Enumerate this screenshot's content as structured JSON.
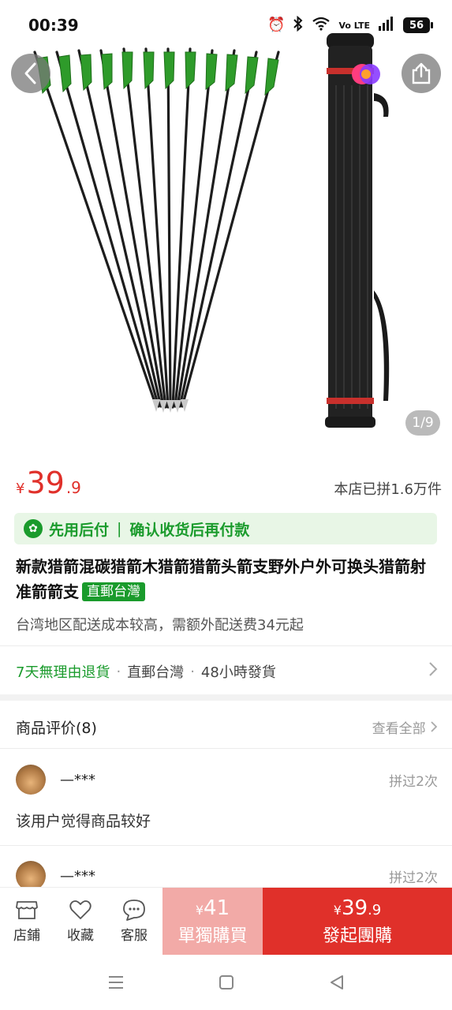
{
  "status_bar": {
    "time": "00:39",
    "network": "Vo LTE",
    "battery": "56"
  },
  "gallery": {
    "counter": "1/9"
  },
  "price": {
    "currency": "¥",
    "integer": "39",
    "decimal": ".9",
    "sold_text": "本店已拼1.6万件"
  },
  "pay_later": {
    "label": "先用后付",
    "separator": "|",
    "desc": "确认收货后再付款"
  },
  "product": {
    "title": "新款猎箭混碳猎箭木猎箭猎箭头箭支野外户外可换头猎箭射准箭箭支",
    "tag": "直郵台灣",
    "shipping_note": "台湾地区配送成本较高，需额外配送费34元起"
  },
  "services": {
    "return": "7天無理由退貨",
    "direct": "直郵台灣",
    "ship_time": "48小時發貨",
    "dot": "·"
  },
  "reviews": {
    "title": "商品评价(8)",
    "see_all": "查看全部",
    "items": [
      {
        "user": "—***",
        "joined": "拼过2次",
        "text": "该用户觉得商品较好"
      },
      {
        "user": "—***",
        "joined": "拼过2次"
      }
    ]
  },
  "action_bar": {
    "store": "店鋪",
    "favorite": "收藏",
    "service": "客服",
    "solo": {
      "currency": "¥",
      "price": "41",
      "label": "單獨購買"
    },
    "group": {
      "currency": "¥",
      "integer": "39",
      "decimal": ".9",
      "label": "發起團購"
    }
  },
  "colors": {
    "accent_red": "#e0302a",
    "green": "#1a9b2c",
    "solo_pink": "#f2aaa7"
  }
}
